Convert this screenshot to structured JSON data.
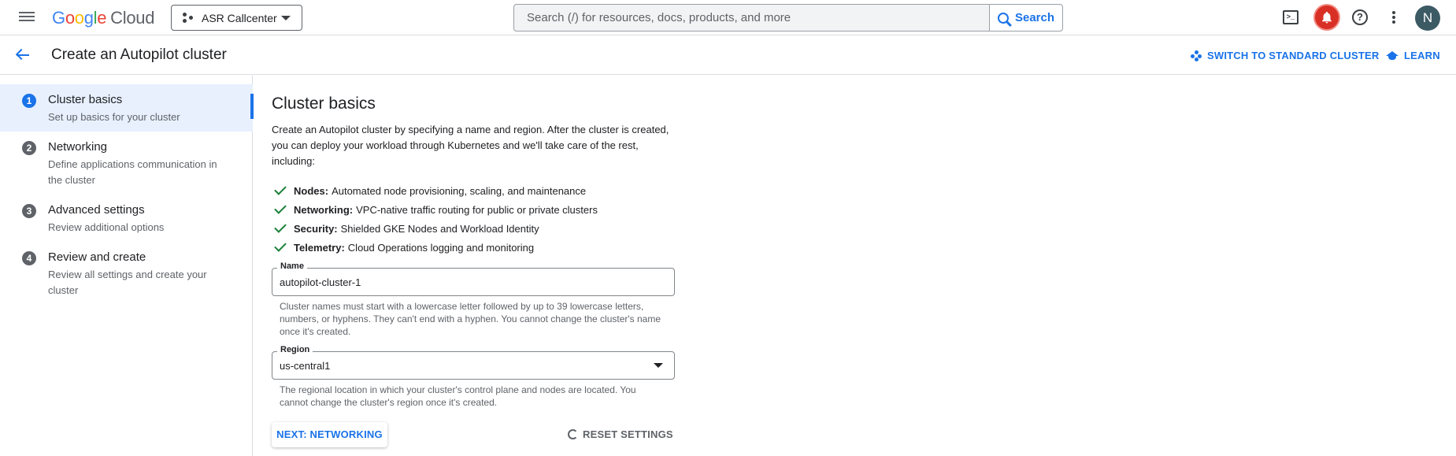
{
  "topbar": {
    "logo_letters": [
      "G",
      "o",
      "o",
      "g",
      "l",
      "e"
    ],
    "logo_product": "Cloud",
    "project_name": "ASR Callcenter",
    "search_placeholder": "Search (/) for resources, docs, products, and more",
    "search_button": "Search",
    "terminal_glyph": ">_",
    "help_glyph": "?",
    "avatar_initial": "N"
  },
  "header": {
    "title": "Create an Autopilot cluster",
    "switch_label": "SWITCH TO STANDARD CLUSTER",
    "learn_label": "LEARN"
  },
  "steps": [
    {
      "number": "1",
      "title": "Cluster basics",
      "subtitle": "Set up basics for your cluster",
      "active": true
    },
    {
      "number": "2",
      "title": "Networking",
      "subtitle": "Define applications communication in the cluster",
      "active": false
    },
    {
      "number": "3",
      "title": "Advanced settings",
      "subtitle": "Review additional options",
      "active": false
    },
    {
      "number": "4",
      "title": "Review and create",
      "subtitle": "Review all settings and create your cluster",
      "active": false
    }
  ],
  "main": {
    "title": "Cluster basics",
    "intro": "Create an Autopilot cluster by specifying a name and region. After the cluster is created, you can deploy your workload through Kubernetes and we'll take care of the rest, including:",
    "features": [
      {
        "label": "Nodes:",
        "text": "Automated node provisioning, scaling, and maintenance"
      },
      {
        "label": "Networking:",
        "text": "VPC-native traffic routing for public or private clusters"
      },
      {
        "label": "Security:",
        "text": "Shielded GKE Nodes and Workload Identity"
      },
      {
        "label": "Telemetry:",
        "text": "Cloud Operations logging and monitoring"
      }
    ],
    "name_field": {
      "label": "Name",
      "value": "autopilot-cluster-1",
      "hint": "Cluster names must start with a lowercase letter followed by up to 39 lowercase letters, numbers, or hyphens. They can't end with a hyphen. You cannot change the cluster's name once it's created."
    },
    "region_field": {
      "label": "Region",
      "value": "us-central1",
      "hint": "The regional location in which your cluster's control plane and nodes are located. You cannot change the cluster's region once it's created."
    },
    "next_button": "NEXT: NETWORKING",
    "reset_button": "RESET SETTINGS"
  },
  "colors": {
    "accent": "#1a73e8",
    "check": "#188038",
    "notification": "#d93025"
  }
}
